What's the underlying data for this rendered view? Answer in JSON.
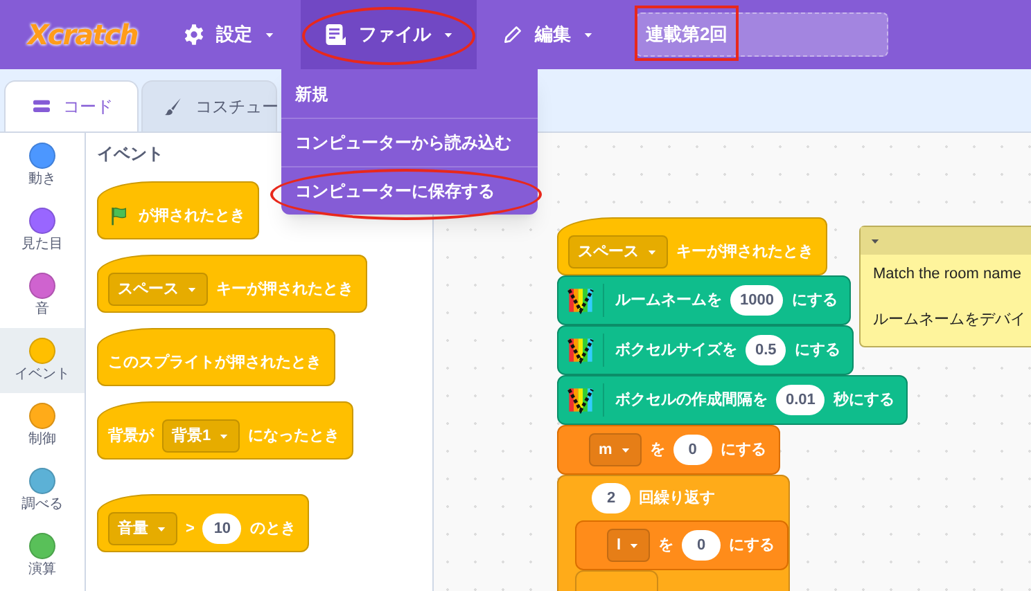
{
  "menubar": {
    "logo": "Xcratch",
    "menus": [
      {
        "label": "設定",
        "open": false,
        "circled": false
      },
      {
        "label": "ファイル",
        "open": true,
        "circled": true
      },
      {
        "label": "編集",
        "open": false,
        "circled": false
      }
    ],
    "project_title": {
      "value": "連載第2回",
      "boxed": true
    }
  },
  "file_menu": {
    "items": [
      {
        "label": "新規",
        "circled": false
      },
      {
        "label": "コンピューターから読み込む",
        "circled": false
      },
      {
        "label": "コンピューターに保存する",
        "circled": true
      }
    ]
  },
  "tabs": [
    {
      "label": "コード",
      "selected": true
    },
    {
      "label": "コスチュー",
      "selected": false
    }
  ],
  "categories": [
    {
      "label": "動き",
      "color": "#4c97ff",
      "selected": false
    },
    {
      "label": "見た目",
      "color": "#9966ff",
      "selected": false
    },
    {
      "label": "音",
      "color": "#cf63cf",
      "selected": false
    },
    {
      "label": "イベント",
      "color": "#ffbf00",
      "selected": true
    },
    {
      "label": "制御",
      "color": "#ffab19",
      "selected": false
    },
    {
      "label": "調べる",
      "color": "#5cb1d6",
      "selected": false
    },
    {
      "label": "演算",
      "color": "#59c059",
      "selected": false
    }
  ],
  "palette": {
    "heading": "イベント",
    "blocks": [
      {
        "kind": "hat",
        "parts": [
          {
            "kind": "flag"
          },
          {
            "kind": "text",
            "text": "が押されたとき"
          }
        ]
      },
      {
        "kind": "hat",
        "parts": [
          {
            "kind": "dropdown",
            "text": "スペース"
          },
          {
            "kind": "text",
            "text": "キーが押されたとき"
          }
        ]
      },
      {
        "kind": "hat",
        "parts": [
          {
            "kind": "text",
            "text": "このスプライトが押されたとき"
          }
        ]
      },
      {
        "kind": "hat",
        "parts": [
          {
            "kind": "text",
            "text": "背景が"
          },
          {
            "kind": "dropdown",
            "text": "背景1"
          },
          {
            "kind": "text",
            "text": "になったとき"
          }
        ]
      },
      {
        "kind": "hat",
        "parts": [
          {
            "kind": "dropdown",
            "text": "音量"
          },
          {
            "kind": "text",
            "text": ">"
          },
          {
            "kind": "number",
            "text": "10"
          },
          {
            "kind": "text",
            "text": "のとき"
          }
        ]
      }
    ]
  },
  "script": [
    {
      "kind": "hat",
      "parts": [
        {
          "kind": "dropdown",
          "text": "スペース"
        },
        {
          "kind": "text",
          "text": "キーが押されたとき"
        }
      ]
    },
    {
      "kind": "extension",
      "parts": [
        {
          "kind": "extension"
        },
        {
          "kind": "text",
          "text": "ルームネームを"
        },
        {
          "kind": "number",
          "text": "1000"
        },
        {
          "kind": "text",
          "text": "にする"
        }
      ]
    },
    {
      "kind": "extension",
      "parts": [
        {
          "kind": "extension"
        },
        {
          "kind": "text",
          "text": "ボクセルサイズを"
        },
        {
          "kind": "number",
          "text": "0.5"
        },
        {
          "kind": "text",
          "text": "にする"
        }
      ]
    },
    {
      "kind": "extension",
      "parts": [
        {
          "kind": "extension"
        },
        {
          "kind": "text",
          "text": "ボクセルの作成間隔を"
        },
        {
          "kind": "number",
          "text": "0.01"
        },
        {
          "kind": "text",
          "text": "秒にする"
        }
      ]
    },
    {
      "kind": "variable",
      "parts": [
        {
          "kind": "dropdown",
          "text": "m"
        },
        {
          "kind": "text",
          "text": "を"
        },
        {
          "kind": "number",
          "text": "0"
        },
        {
          "kind": "text",
          "text": "にする"
        }
      ]
    },
    {
      "kind": "repeat",
      "parts": [
        {
          "kind": "number",
          "text": "2"
        },
        {
          "kind": "text",
          "text": "回繰り返す"
        }
      ],
      "children": [
        {
          "kind": "variable",
          "parts": [
            {
              "kind": "dropdown",
              "text": "l"
            },
            {
              "kind": "text",
              "text": "を"
            },
            {
              "kind": "number",
              "text": "0"
            },
            {
              "kind": "text",
              "text": "にする"
            }
          ]
        },
        {
          "kind": "control"
        }
      ]
    }
  ],
  "comment": {
    "lines": [
      "Match the room name",
      "ルームネームをデバイ"
    ]
  }
}
